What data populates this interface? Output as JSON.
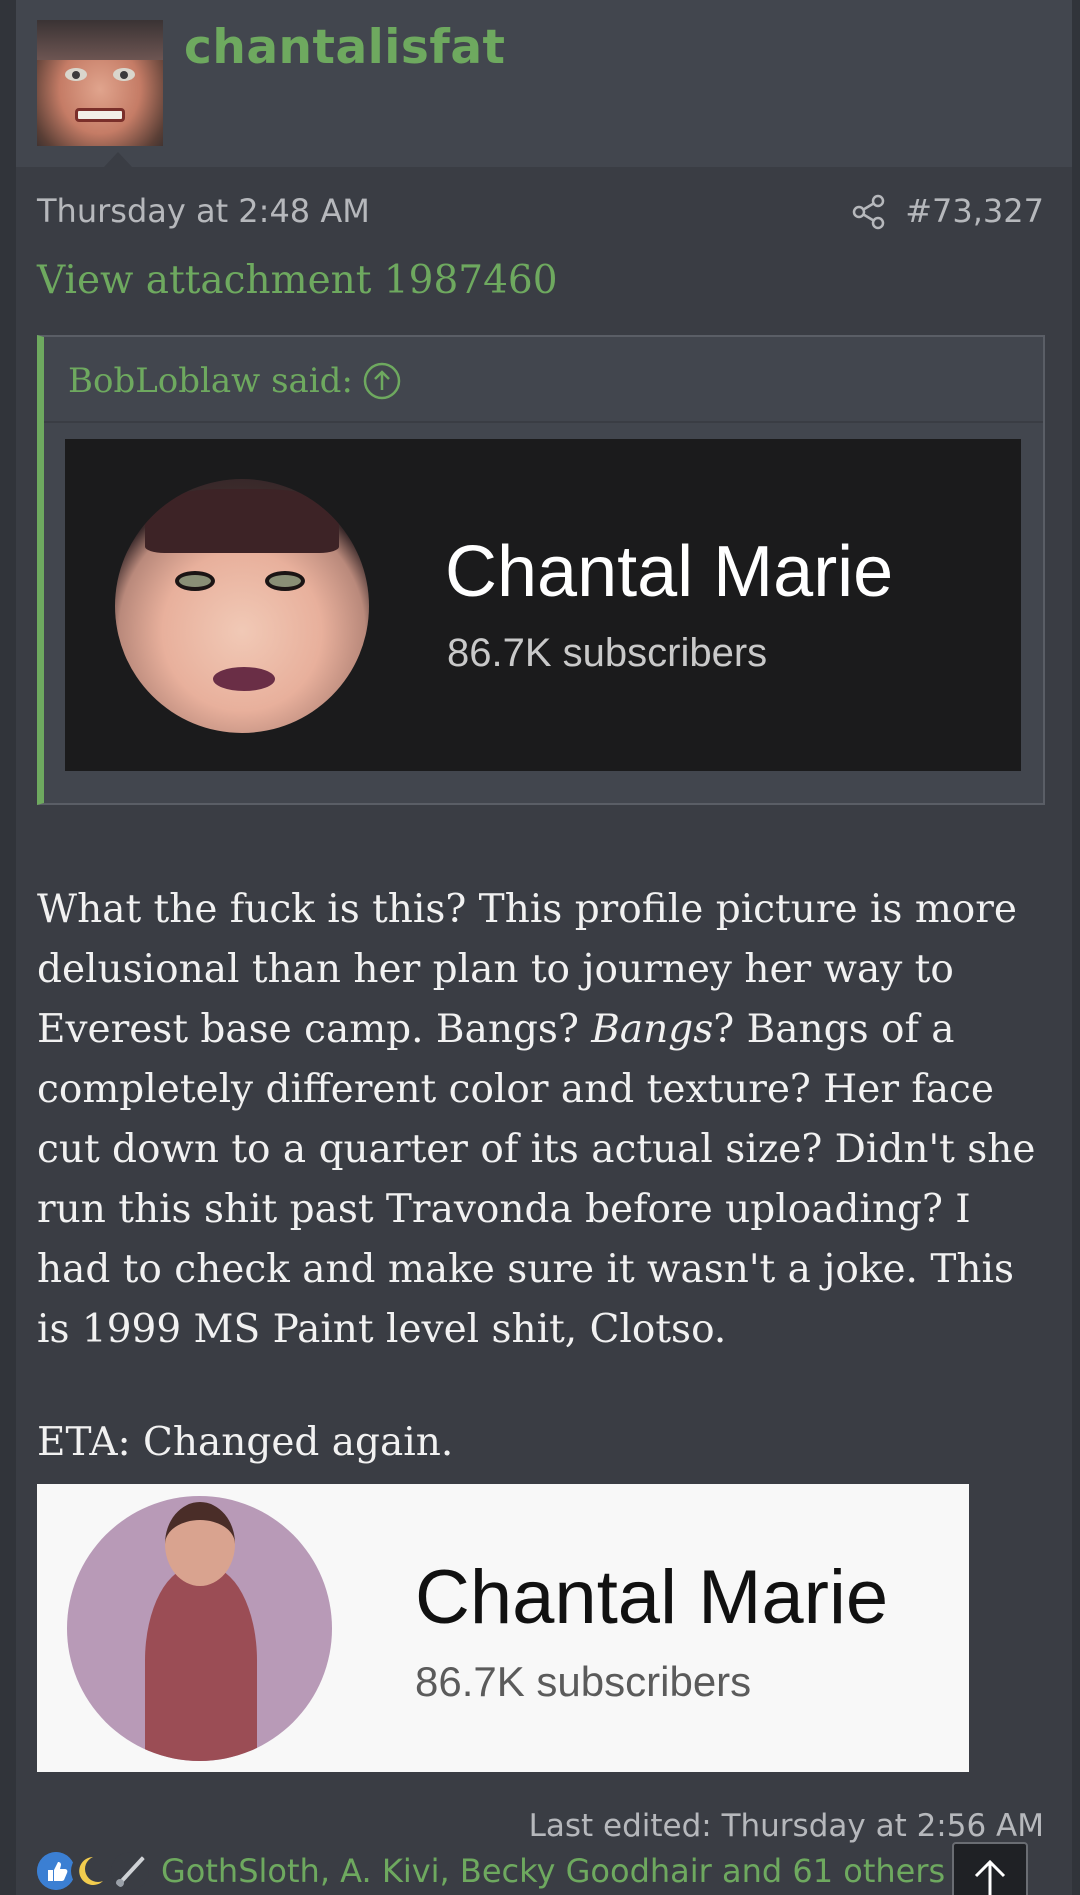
{
  "post": {
    "username": "chantalisfat",
    "date": "Thursday at 2:48 AM",
    "post_number": "#73,327",
    "attachment_link": "View attachment 1987460"
  },
  "quote": {
    "author": "BobLoblaw said:",
    "card": {
      "name": "Chantal Marie",
      "subscribers": "86.7K subscribers"
    }
  },
  "body": {
    "para1_a": "What the fuck is this? This profile picture is more delusional than her plan to journey her way to Everest base camp. Bangs? ",
    "para1_em": "Bangs",
    "para1_b": "? Bangs of a completely different color and texture? Her face cut down to a quarter of its actual size? Didn't she run this shit past Travonda before uploading? I had to check and make sure it wasn't a joke. This is 1999 MS Paint level shit, Clotso.",
    "eta": "ETA: Changed again."
  },
  "image2": {
    "name": "Chantal Marie",
    "subscribers": "86.7K subscribers"
  },
  "footer": {
    "last_edited": "Last edited: Thursday at 2:56 AM",
    "reactors": "GothSloth, A. Kivi, Becky Goodhair and 61 others"
  },
  "colors": {
    "accent": "#6ea95f",
    "background": "#3a3d44",
    "header": "#42464e"
  },
  "icons": [
    "share-icon",
    "arrow-up-circle-icon",
    "like-reaction-icon",
    "moon-reaction-icon",
    "paintbrush-reaction-icon",
    "arrow-up-icon"
  ]
}
